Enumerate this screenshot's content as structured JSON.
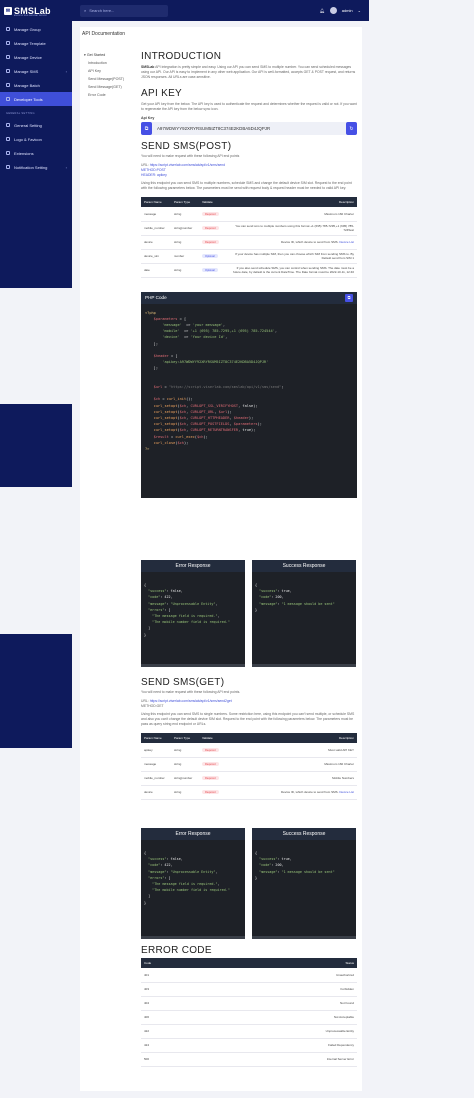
{
  "brand": {
    "name": "SMSLab",
    "tagline": "ANDROID SMS GATEWAY SERVER"
  },
  "search": {
    "placeholder": "Search here..."
  },
  "user": {
    "name": "admin"
  },
  "sidebar": {
    "items": [
      {
        "label": "Manage Group",
        "icon": "users-icon"
      },
      {
        "label": "Manage Template",
        "icon": "template-icon"
      },
      {
        "label": "Manage Device",
        "icon": "device-icon"
      },
      {
        "label": "Manage SMS",
        "icon": "sms-icon",
        "chevron": true
      },
      {
        "label": "Manage Batch",
        "icon": "batch-icon"
      },
      {
        "label": "Developer Tools",
        "icon": "code-icon",
        "active": true
      }
    ],
    "section": "GENERAL SETTING",
    "settings": [
      {
        "label": "General Setting",
        "icon": "gear-icon"
      },
      {
        "label": "Logo & Favicon",
        "icon": "image-icon"
      },
      {
        "label": "Extensions",
        "icon": "puzzle-icon"
      },
      {
        "label": "Notification Setting",
        "icon": "bell-icon",
        "chevron": true
      }
    ]
  },
  "page": {
    "title": "API Documentation"
  },
  "toc": {
    "head": "Get Started",
    "items": [
      "Introduction",
      "API Key",
      "Send Message(POST)",
      "Send Message(GET)",
      "Error Code"
    ]
  },
  "intro": {
    "heading": "INTRODUCTION",
    "lead": "SMSLab",
    "text": "API integration is pretty simple and easy. Using our API you can send SMS to multiple number. You can send scheduled messages using our API. Our API is easy to implement in any other web application. Our API is well-formatted, accepts GET & POST request, and returns JSON responses. All URLs are case-sensitive."
  },
  "apikey": {
    "heading": "API KEY",
    "text": "Get your API key from the below. The API key is used to authenticate the request and determines whether the request is valid or not. If you want to regenerate the API key from the below sync icon.",
    "label": "Api Key",
    "value": "A97WDWYY92XRYRSUM5IZT8C374E2KDBA5D4JQPJR"
  },
  "post": {
    "heading": "SEND SMS(POST)",
    "intro": "You will need to make request with these following API end points",
    "url_label": "URL:",
    "url": "https://script.viserlab.com/smslab/api/v1/sms/send",
    "method": "METHOD:POST",
    "header": "HEADER: apikey",
    "desc": "Using this endpoint you can send SMS to multiple numbers, schedule SMS and change the default device SIM slot. Request to the end point with the following parameters below. The parameters must be send with request body & request header must be needed to valid API key.",
    "columns": [
      "Param Name",
      "Param Type",
      "Validate",
      "Description"
    ],
    "rows": [
      {
        "name": "message",
        "type": "string",
        "validate": "Required",
        "desc": "Maximum 160 Charter"
      },
      {
        "name": "mobile_number",
        "type": "string|number",
        "validate": "Required",
        "desc": "You can send sms to multiple numbers using this format +1 (695) 785-7295,+1 (695) 785-7245est"
      },
      {
        "name": "device",
        "type": "string",
        "validate": "Required",
        "desc": "Device ID, which device to send from SMS.",
        "link": "Device List"
      },
      {
        "name": "device_sim",
        "type": "number",
        "validate": "Optional",
        "desc": "If your device has multiple SIM, then you can choose which SIM from sending SMS to. By Default send from SIM 1"
      },
      {
        "name": "date",
        "type": "string",
        "validate": "Optional",
        "desc": "If you also send schedule SMS, you can control when sending SMS. The date must be a future date, by default is the current DateTime. The Date format must be 2022-10-11, 12:40"
      }
    ],
    "code_title": "PHP Code"
  },
  "responses": {
    "error_title": "Error Response",
    "success_title": "Success Response"
  },
  "get": {
    "heading": "SEND SMS(GET)",
    "intro": "You will need to make request with these following API end points.",
    "url_label": "URL:",
    "url": "https://script.viserlab.com/smslab/api/v1/sms/send2get",
    "method": "METHOD:GET",
    "desc": "Using this endpoint you can send SMS to single numbers. Some restriction here, using this endpoint you can't send multiple, or schedule SMS and also you can't change the default device SIM slot. Request to the end point with the following parameters below. The parameters must be pass as query string end endpoint or URLs.",
    "columns": [
      "Param Name",
      "Param Type",
      "Validate",
      "Description"
    ],
    "rows": [
      {
        "name": "apikey",
        "type": "string",
        "validate": "Required",
        "desc": "Must valid API KEY"
      },
      {
        "name": "message",
        "type": "string",
        "validate": "Required",
        "desc": "Maximum 160 Charter"
      },
      {
        "name": "mobile_number",
        "type": "string|number",
        "validate": "Required",
        "desc": "Mobile Numbers"
      },
      {
        "name": "device",
        "type": "string",
        "validate": "Required",
        "desc": "Device ID, which device to send from SMS.",
        "link": "Device List"
      }
    ]
  },
  "errors": {
    "heading": "ERROR CODE",
    "columns": [
      "Code",
      "Status"
    ],
    "rows": [
      {
        "code": "401",
        "status": "Unauthorized"
      },
      {
        "code": "403",
        "status": "Forbidden"
      },
      {
        "code": "404",
        "status": "Not Found"
      },
      {
        "code": "406",
        "status": "Not Acceptable"
      },
      {
        "code": "422",
        "status": "Unprocessable Entity"
      },
      {
        "code": "424",
        "status": "Failed Dependency"
      },
      {
        "code": "500",
        "status": "Internal Server Error"
      }
    ]
  },
  "colors": {
    "sidebar": "#0e1a5c",
    "accent": "#4650e5",
    "table_head": "#232c3d",
    "code_bg": "#1e2127"
  }
}
